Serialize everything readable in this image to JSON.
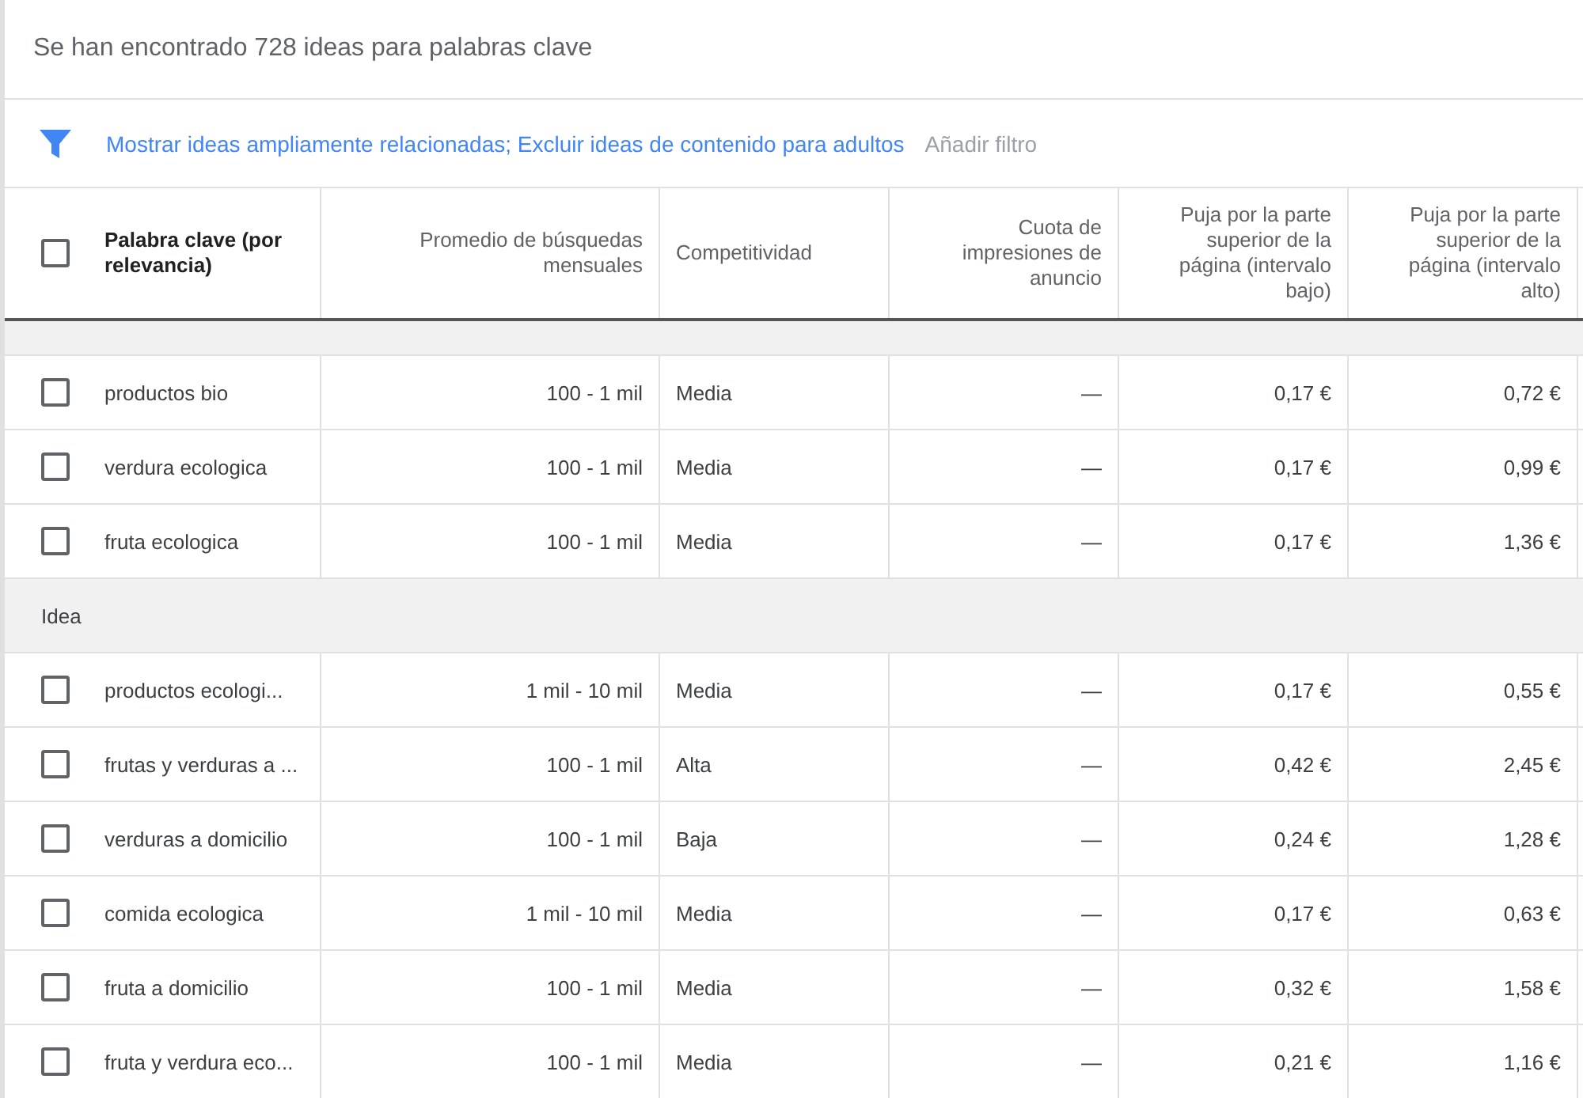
{
  "title": "Se han encontrado 728 ideas para palabras clave",
  "filter": {
    "applied": "Mostrar ideas ampliamente relacionadas; Excluir ideas de contenido para adultos",
    "add": "Añadir filtro"
  },
  "table": {
    "select_all_checked": false,
    "columns": [
      {
        "label": "Palabra clave (por relevancia)"
      },
      {
        "label": "Promedio de búsquedas mensuales"
      },
      {
        "label": "Competitividad"
      },
      {
        "label": "Cuota de impresiones de anuncio"
      },
      {
        "label": "Puja por la parte superior de la página (intervalo bajo)"
      },
      {
        "label": "Puja por la parte superior de la página (intervalo alto)"
      }
    ],
    "groups": [
      {
        "rows": [
          {
            "checked": false,
            "cells": [
              "productos bio",
              "100 - 1 mil",
              "Media",
              "—",
              "0,17 €",
              "0,72 €"
            ]
          },
          {
            "checked": false,
            "cells": [
              "verdura ecologica",
              "100 - 1 mil",
              "Media",
              "—",
              "0,17 €",
              "0,99 €"
            ]
          },
          {
            "checked": false,
            "cells": [
              "fruta ecologica",
              "100 - 1 mil",
              "Media",
              "—",
              "0,17 €",
              "1,36 €"
            ]
          }
        ]
      },
      {
        "name": "Idea",
        "rows": [
          {
            "checked": false,
            "cells": [
              "productos ecologi...",
              "1 mil - 10 mil",
              "Media",
              "—",
              "0,17 €",
              "0,55 €"
            ]
          },
          {
            "checked": false,
            "cells": [
              "frutas y verduras a ...",
              "100 - 1 mil",
              "Alta",
              "—",
              "0,42 €",
              "2,45 €"
            ]
          },
          {
            "checked": false,
            "cells": [
              "verduras a domicilio",
              "100 - 1 mil",
              "Baja",
              "—",
              "0,24 €",
              "1,28 €"
            ]
          },
          {
            "checked": false,
            "cells": [
              "comida ecologica",
              "1 mil - 10 mil",
              "Media",
              "—",
              "0,17 €",
              "0,63 €"
            ]
          },
          {
            "checked": false,
            "cells": [
              "fruta a domicilio",
              "100 - 1 mil",
              "Media",
              "—",
              "0,32 €",
              "1,58 €"
            ]
          },
          {
            "checked": false,
            "cells": [
              "fruta y verdura eco...",
              "100 - 1 mil",
              "Media",
              "—",
              "0,21 €",
              "1,16 €"
            ]
          }
        ]
      }
    ]
  }
}
